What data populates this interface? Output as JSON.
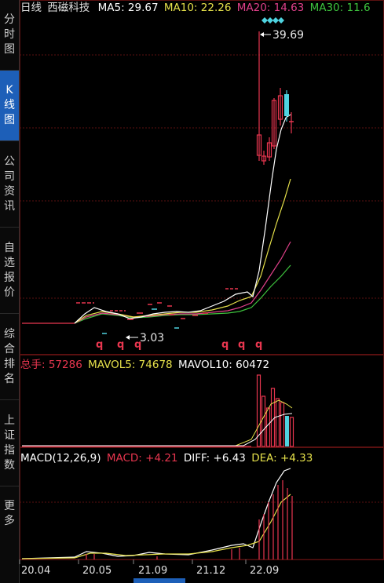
{
  "sidebar": {
    "tabs": [
      {
        "label": "分时图",
        "active": false
      },
      {
        "label": "K线图",
        "active": true
      },
      {
        "label": "公司资讯",
        "active": false
      },
      {
        "label": "自选报价",
        "active": false
      },
      {
        "label": "综合排名",
        "active": false
      },
      {
        "label": "上证指数",
        "active": false
      },
      {
        "label": "更多",
        "active": false
      }
    ]
  },
  "header": {
    "period": "日线",
    "stock_name": "西磁科技",
    "ma5": "MA5: 29.67",
    "ma10": "MA10: 22.26",
    "ma20": "MA20: 14.63",
    "ma30": "MA30: 11.6"
  },
  "price_annotations": {
    "high": "39.69",
    "low": "3.03",
    "markers": [
      "q",
      "q",
      "q",
      "q",
      "q",
      "q"
    ]
  },
  "volume_header": {
    "total": "总手: 57286",
    "mavol5": "MAVOL5: 74678",
    "mavol10": "MAVOL10: 60472"
  },
  "macd_header": {
    "name": "MACD(12,26,9)",
    "macd": "MACD: +4.21",
    "diff": "DIFF: +6.43",
    "dea": "DEA: +4.33"
  },
  "x_axis": {
    "labels": [
      "20.04",
      "20.05",
      "21.09",
      "21.12",
      "22.09"
    ]
  },
  "colors": {
    "up": "#e8364f",
    "down": "#4fd3e0",
    "ma5": "#ffffff",
    "ma10": "#e5e04a",
    "ma20": "#e0408a",
    "ma30": "#3ec43e",
    "active_tab": "#1d5fb8",
    "grid": "#5a1010"
  },
  "chart_data": {
    "type": "candlestick",
    "series": [
      {
        "name": "MA5",
        "last": 29.67
      },
      {
        "name": "MA10",
        "last": 22.26
      },
      {
        "name": "MA20",
        "last": 14.63
      },
      {
        "name": "MA30",
        "last": 11.6
      }
    ],
    "annotations": {
      "high": 39.69,
      "low": 3.03
    },
    "volume": {
      "total": 57286,
      "mavol5": 74678,
      "mavol10": 60472
    },
    "macd": {
      "params": "12,26,9",
      "macd": 4.21,
      "diff": 6.43,
      "dea": 4.33
    },
    "x_ticks": [
      "20.04",
      "20.05",
      "21.09",
      "21.12",
      "22.09"
    ]
  }
}
